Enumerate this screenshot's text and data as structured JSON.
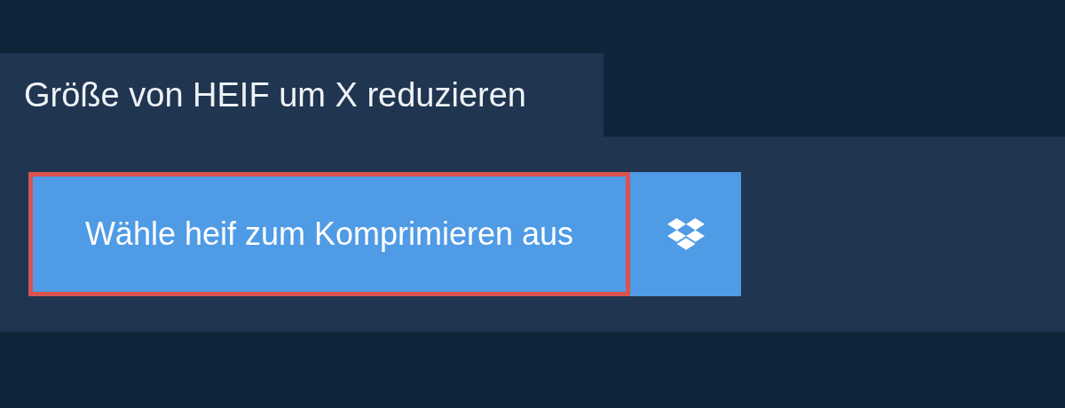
{
  "tab": {
    "label": "Größe von HEIF um X reduzieren"
  },
  "choose_button": {
    "label": "Wähle heif zum Komprimieren aus",
    "highlighted": true
  }
}
